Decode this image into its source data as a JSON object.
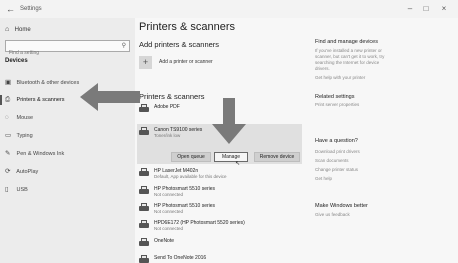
{
  "window": {
    "back_glyph": "←",
    "title": "Settings",
    "controls": {
      "minimize": "–",
      "maximize": "□",
      "close": "×"
    }
  },
  "sidebar": {
    "home_label": "Home",
    "search_placeholder": "Find a setting",
    "section_heading": "Devices",
    "items": [
      {
        "label": "Bluetooth & other devices",
        "icon": "bluetooth-icon"
      },
      {
        "label": "Printers & scanners",
        "icon": "printer-icon",
        "active": true
      },
      {
        "label": "Mouse",
        "icon": "mouse-icon"
      },
      {
        "label": "Typing",
        "icon": "keyboard-icon"
      },
      {
        "label": "Pen & Windows Ink",
        "icon": "pen-icon"
      },
      {
        "label": "AutoPlay",
        "icon": "autoplay-icon"
      },
      {
        "label": "USB",
        "icon": "usb-icon"
      }
    ]
  },
  "main": {
    "page_title": "Printers & scanners",
    "add_heading": "Add printers & scanners",
    "add_button_label": "Add a printer or scanner",
    "list_heading": "Printers & scanners",
    "printers": [
      {
        "name": "Adobe PDF",
        "status": ""
      },
      {
        "name": "Canon TS9100 series",
        "status": "Toner/ink low",
        "selected": true
      },
      {
        "name": "HP LaserJet M402n",
        "status": "Default, App available for this device"
      },
      {
        "name": "HP Photosmart 5510 series",
        "status": "Not connected"
      },
      {
        "name": "HP Photosmart 5510 series",
        "status": "Not connected"
      },
      {
        "name": "HPD6E172 (HP Photosmart 5520 series)",
        "status": "Not connected"
      },
      {
        "name": "OneNote",
        "status": ""
      },
      {
        "name": "Send To OneNote 2016",
        "status": ""
      }
    ],
    "actions": {
      "open_queue": "Open queue",
      "manage": "Manage",
      "remove_device": "Remove device"
    }
  },
  "right": {
    "find_heading": "Find and manage devices",
    "find_lines": [
      "If you've installed a new printer or",
      "scanner, but can't get it to work, try",
      "searching the Internet for device",
      "drivers.",
      "Get help with your printer"
    ],
    "related_heading": "Related settings",
    "related_link": "Print server properties",
    "question_heading": "Have a question?",
    "question_links": [
      "Download print drivers",
      "Scan documents",
      "Change printer status",
      "Get help"
    ],
    "better_heading": "Make Windows better",
    "feedback_link": "Give us feedback"
  },
  "colors": {
    "arrow": "#7a7a7a",
    "selected_panel": "#e0e0e0"
  }
}
